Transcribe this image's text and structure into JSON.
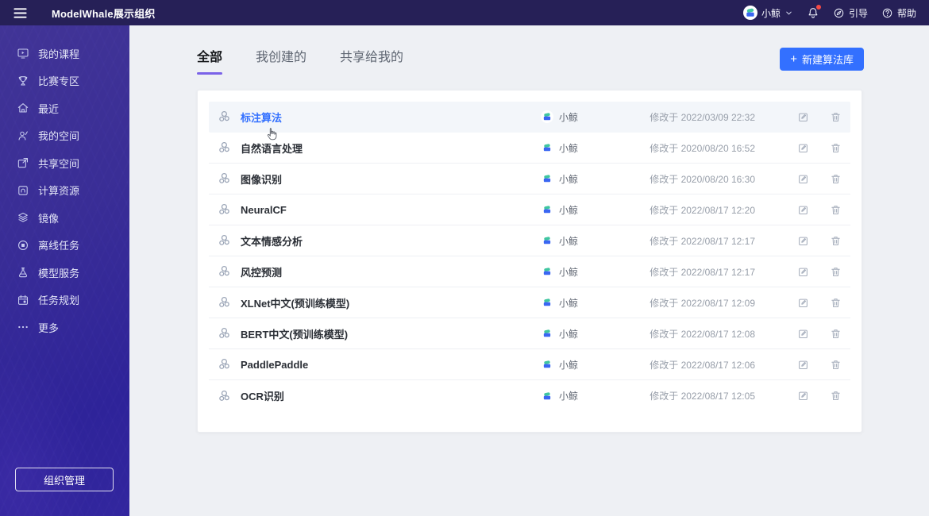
{
  "topbar": {
    "menu_icon": "hamburger-icon",
    "title": "ModelWhale展示组织",
    "user": {
      "name": "小鲸",
      "avatar_icon": "whale-icon",
      "chevron_icon": "chevron-down-icon"
    },
    "notifications": {
      "icon": "bell-icon",
      "has_unread": true
    },
    "guide": {
      "icon": "compass-icon",
      "label": "引导"
    },
    "help": {
      "icon": "question-icon",
      "label": "帮助"
    }
  },
  "sidebar": {
    "items": [
      {
        "label": "我的课程",
        "icon": "course-icon"
      },
      {
        "label": "比赛专区",
        "icon": "contest-icon"
      },
      {
        "label": "最近",
        "icon": "recent-icon"
      },
      {
        "label": "我的空间",
        "icon": "myspace-icon"
      },
      {
        "label": "共享空间",
        "icon": "shared-icon"
      },
      {
        "label": "计算资源",
        "icon": "compute-icon"
      },
      {
        "label": "镜像",
        "icon": "mirror-icon"
      },
      {
        "label": "离线任务",
        "icon": "offline-icon"
      },
      {
        "label": "模型服务",
        "icon": "model-icon"
      },
      {
        "label": "任务规划",
        "icon": "schedule-icon"
      },
      {
        "label": "更多",
        "icon": "more-icon"
      }
    ],
    "org_button": "组织管理"
  },
  "main": {
    "tabs": [
      {
        "label": "全部",
        "active": true
      },
      {
        "label": "我创建的",
        "active": false
      },
      {
        "label": "共享给我的",
        "active": false
      }
    ],
    "new_button": {
      "plus": "+",
      "label": "新建算法库"
    },
    "rows": [
      {
        "icon": "cluster-icon",
        "name": "标注算法",
        "owner": "小鲸",
        "modified": "修改于 2022/03/09 22:32",
        "highlight": true
      },
      {
        "icon": "cluster-icon",
        "name": "自然语言处理",
        "owner": "小鲸",
        "modified": "修改于 2020/08/20 16:52",
        "highlight": false
      },
      {
        "icon": "cluster-icon",
        "name": "图像识别",
        "owner": "小鲸",
        "modified": "修改于 2020/08/20 16:30",
        "highlight": false
      },
      {
        "icon": "cluster-icon",
        "name": "NeuralCF",
        "owner": "小鲸",
        "modified": "修改于 2022/08/17 12:20",
        "highlight": false
      },
      {
        "icon": "cluster-icon",
        "name": "文本情感分析",
        "owner": "小鲸",
        "modified": "修改于 2022/08/17 12:17",
        "highlight": false
      },
      {
        "icon": "cluster-icon",
        "name": "风控预测",
        "owner": "小鲸",
        "modified": "修改于 2022/08/17 12:17",
        "highlight": false
      },
      {
        "icon": "cluster-icon",
        "name": "XLNet中文(预训练模型)",
        "owner": "小鲸",
        "modified": "修改于 2022/08/17 12:09",
        "highlight": false
      },
      {
        "icon": "cluster-icon",
        "name": "BERT中文(预训练模型)",
        "owner": "小鲸",
        "modified": "修改于 2022/08/17 12:08",
        "highlight": false
      },
      {
        "icon": "cluster-icon",
        "name": "PaddlePaddle",
        "owner": "小鲸",
        "modified": "修改于 2022/08/17 12:06",
        "highlight": false
      },
      {
        "icon": "cluster-icon",
        "name": "OCR识别",
        "owner": "小鲸",
        "modified": "修改于 2022/08/17 12:05",
        "highlight": false
      }
    ],
    "row_action_icons": [
      "edit-icon",
      "trash-icon"
    ]
  },
  "colors": {
    "topbar_bg": "#262057",
    "sidebar_bg": "#382c96",
    "accent_blue": "#3370ff",
    "accent_purple": "#7a62e8",
    "notification_dot": "#f54a45",
    "link_hover_row_bg": "#f3f6fa"
  }
}
